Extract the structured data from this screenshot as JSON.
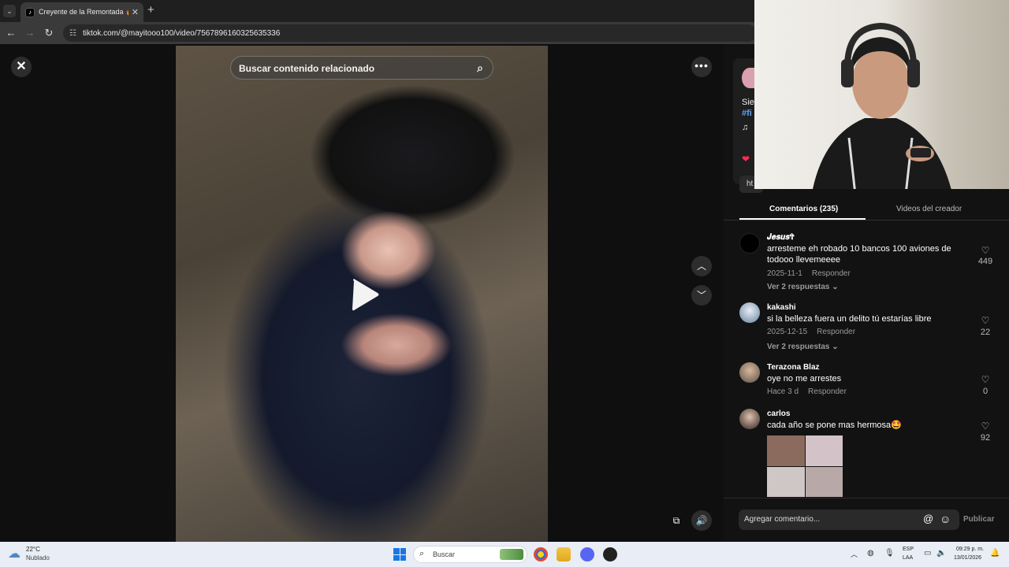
{
  "browser": {
    "tab_title": "Creyente de la Remontada 🔥",
    "tab_favicon": "tiktok-icon",
    "url": "tiktok.com/@mayitooo100/video/7567896160325635336"
  },
  "player": {
    "search_placeholder": "Buscar contenido relacionado"
  },
  "creator": {
    "desc_prefix": "Sie",
    "hashtag_prefix": "#fi",
    "link_prefix": "ht"
  },
  "comments_panel": {
    "tab_comments": "Comentarios (235)",
    "tab_videos": "Videos del creador",
    "items": [
      {
        "user": "𝑱𝒆𝒔𝒖𝒔✞",
        "text": "arresteme eh robado 10 bancos 100 aviones de todooo llevemeeee",
        "date": "2025-11-1",
        "reply": "Responder",
        "more_replies": "Ver 2 respuestas ⌄",
        "likes": "449"
      },
      {
        "user": "kakashi",
        "text": "si la belleza fuera un delito tú estarías libre",
        "date": "2025-12-15",
        "reply": "Responder",
        "more_replies": "Ver 2 respuestas ⌄",
        "likes": "22"
      },
      {
        "user": "Terazona Blaz",
        "text": "oye no me arrestes",
        "date": "Hace 3 d",
        "reply": "Responder",
        "likes": "0"
      },
      {
        "user": "carlos",
        "text": "cada año se pone mas hermosa🤩",
        "likes": "92"
      }
    ],
    "compose_placeholder": "Agregar comentario...",
    "publish": "Publicar"
  },
  "taskbar": {
    "temp": "22°C",
    "weather": "Nublado",
    "search": "Buscar",
    "lang_1": "ESP",
    "lang_2": "LAA",
    "time": "09:29 p. m.",
    "date": "13/01/2026"
  },
  "colors": {
    "tiktok_red": "#fe2c55",
    "hashtag_blue": "#5fa3ff"
  }
}
